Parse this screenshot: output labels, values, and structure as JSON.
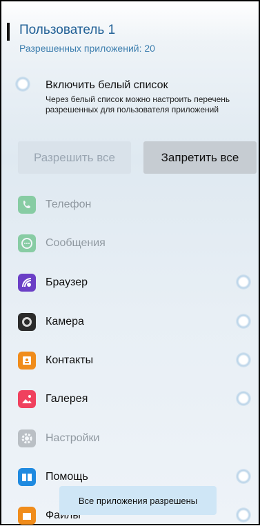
{
  "user": {
    "title": "Пользователь 1",
    "allowed_count": "Разрешенных приложений: 20"
  },
  "whitelist": {
    "title": "Включить белый список",
    "description": "Через белый список можно настроить перечень разрешенных для пользователя приложений"
  },
  "buttons": {
    "allow_all": "Разрешить все",
    "deny_all": "Запретить все"
  },
  "apps": [
    {
      "label": "Телефон",
      "icon": "phone-icon",
      "color": "#2fae57",
      "enabled": false,
      "toggle": false
    },
    {
      "label": "Сообщения",
      "icon": "messages-icon",
      "color": "#2fae57",
      "enabled": false,
      "toggle": false
    },
    {
      "label": "Браузер",
      "icon": "browser-icon",
      "color": "#6b3fc6",
      "enabled": true,
      "toggle": true
    },
    {
      "label": "Камера",
      "icon": "camera-icon",
      "color": "#2b2b2b",
      "enabled": true,
      "toggle": true
    },
    {
      "label": "Контакты",
      "icon": "contacts-icon",
      "color": "#f08c1b",
      "enabled": true,
      "toggle": true
    },
    {
      "label": "Галерея",
      "icon": "gallery-icon",
      "color": "#f0415e",
      "enabled": true,
      "toggle": true
    },
    {
      "label": "Настройки",
      "icon": "settings-icon",
      "color": "#8a8f94",
      "enabled": false,
      "toggle": false
    },
    {
      "label": "Помощь",
      "icon": "help-icon",
      "color": "#1f8ae0",
      "enabled": true,
      "toggle": true
    },
    {
      "label": "Файлы",
      "icon": "files-icon",
      "color": "#f08c1b",
      "enabled": true,
      "toggle": true
    }
  ],
  "toast": "Все приложения разрешены"
}
